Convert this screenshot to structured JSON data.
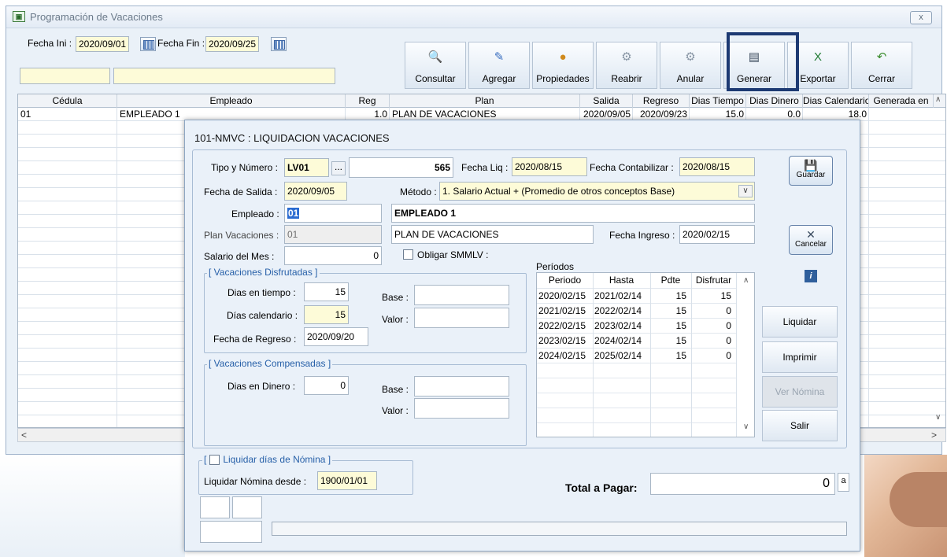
{
  "window": {
    "title": "Programación de Vacaciones",
    "close_label": "x"
  },
  "filters": {
    "fecha_ini_label": "Fecha Ini :",
    "fecha_ini": "2020/09/01",
    "fecha_fin_label": "Fecha Fin :",
    "fecha_fin": "2020/09/25"
  },
  "toolbar": [
    {
      "label": "Consultar",
      "icon": "magnifier-icon",
      "glyph": "🔍",
      "color": "#4c7fbf"
    },
    {
      "label": "Agregar",
      "icon": "new-document-icon",
      "glyph": "✎",
      "color": "#3a6fc0"
    },
    {
      "label": "Propiedades",
      "icon": "properties-icon",
      "glyph": "●",
      "color": "#d08a1c"
    },
    {
      "label": "Reabrir",
      "icon": "reopen-icon",
      "glyph": "⚙",
      "color": "#8a97a6"
    },
    {
      "label": "Anular",
      "icon": "void-icon",
      "glyph": "⚙",
      "color": "#8a97a6"
    },
    {
      "label": "Generar",
      "icon": "generate-document-icon",
      "glyph": "▤",
      "color": "#3b4a5c"
    },
    {
      "label": "Exportar",
      "icon": "excel-icon",
      "glyph": "X",
      "color": "#1f7a32"
    },
    {
      "label": "Cerrar",
      "icon": "undo-arrow-icon",
      "glyph": "↶",
      "color": "#3c8d2f"
    }
  ],
  "grid": {
    "columns": [
      "Cédula",
      "Empleado",
      "Reg",
      "Plan",
      "Salida",
      "Regreso",
      "Dias Tiempo",
      "Dias Dinero",
      "Dias Calendario",
      "Generada en"
    ],
    "rows": [
      [
        "01",
        "EMPLEADO 1",
        "1.0",
        "PLAN DE VACACIONES",
        "2020/09/05",
        "2020/09/23",
        "15.0",
        "0.0",
        "18.0",
        ""
      ]
    ]
  },
  "dialog": {
    "title": "101-NMVC : LIQUIDACION VACACIONES",
    "tipo_label": "Tipo y Número :",
    "tipo": "LV01",
    "ellipsis": "...",
    "numero": "565",
    "fecha_liq_label": "Fecha Liq :",
    "fecha_liq": "2020/08/15",
    "fecha_cont_label": "Fecha Contabilizar :",
    "fecha_cont": "2020/08/15",
    "fecha_salida_label": "Fecha de Salida :",
    "fecha_salida": "2020/09/05",
    "metodo_label": "Método :",
    "metodo": "1. Salario Actual + (Promedio de otros conceptos Base)",
    "empleado_label": "Empleado :",
    "empleado_code": "01",
    "empleado_name": "EMPLEADO 1",
    "plan_label": "Plan Vacaciones :",
    "plan_code": "01",
    "plan_name": "PLAN DE VACACIONES",
    "fecha_ingreso_label": "Fecha Ingreso :",
    "fecha_ingreso": "2020/02/15",
    "salario_label": "Salario del Mes :",
    "salario": "0",
    "obligar_label": "Obligar SMMLV :",
    "disfrutadas_title": "[ Vacaciones Disfrutadas ]",
    "dias_tiempo_label": "Dias en tiempo :",
    "dias_tiempo": "15",
    "dias_cal_label": "Días calendario :",
    "dias_cal": "15",
    "fecha_regreso_label": "Fecha de Regreso :",
    "fecha_regreso": "2020/09/20",
    "base_label": "Base :",
    "valor_label": "Valor :",
    "compensadas_title": "[ Vacaciones Compensadas ]",
    "dias_dinero_label": "Dias en Dinero :",
    "dias_dinero": "0",
    "periodos_label": "Períodos",
    "periodos_cols": [
      "Periodo",
      "Hasta",
      "Pdte",
      "Disfrutar"
    ],
    "periodos_rows": [
      [
        "2020/02/15",
        "2021/02/14",
        "15",
        "15"
      ],
      [
        "2021/02/15",
        "2022/02/14",
        "15",
        "0"
      ],
      [
        "2022/02/15",
        "2023/02/14",
        "15",
        "0"
      ],
      [
        "2023/02/15",
        "2024/02/14",
        "15",
        "0"
      ],
      [
        "2024/02/15",
        "2025/02/14",
        "15",
        "0"
      ]
    ],
    "guardar": "Guardar",
    "cancelar": "Cancelar",
    "liquidar": "Liquidar",
    "imprimir": "Imprimir",
    "ver_nomina": "Ver Nómina",
    "salir": "Salir",
    "nomina_group_title": "Liquidar días de Nómina ]",
    "nomina_group_prefix": "[",
    "liquidar_desde_label": "Liquidar Nómina desde :",
    "liquidar_desde": "1900/01/01",
    "total_label": "Total  a Pagar:",
    "total": "0",
    "total_suffix": "a",
    "info_glyph": "i"
  }
}
